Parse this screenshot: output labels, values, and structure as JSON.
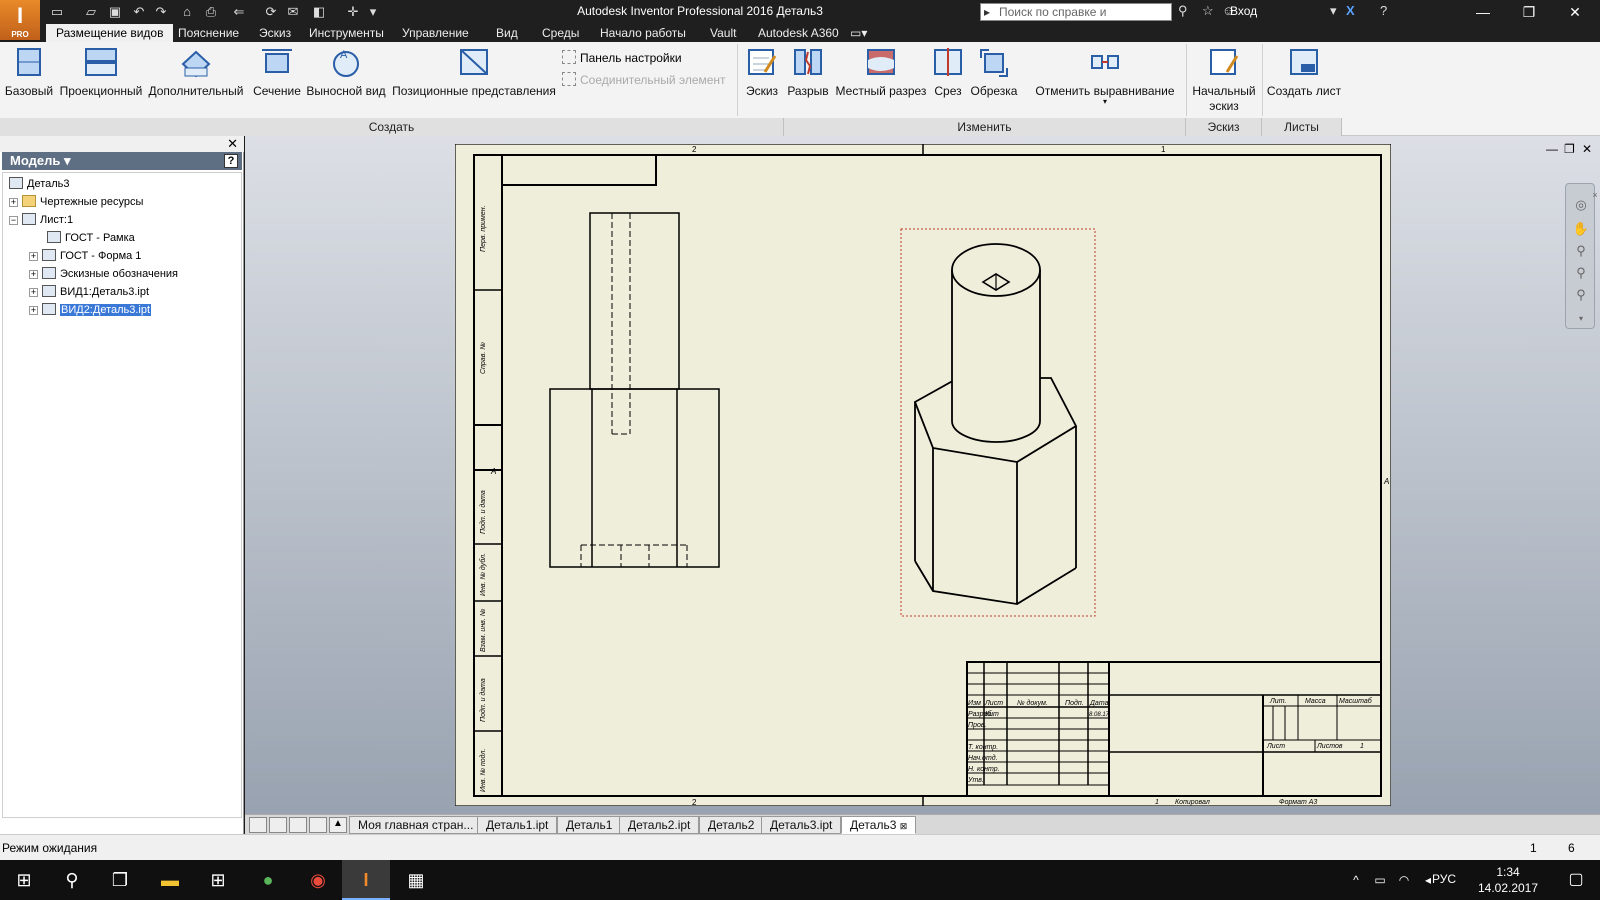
{
  "app": {
    "logo_letter": "I",
    "logo_sub": "PRO",
    "window_title": "Autodesk Inventor Professional 2016   Деталь3",
    "search_placeholder": "Поиск по справке и командам...",
    "signin": "Вход"
  },
  "ribbon_tabs": [
    "Размещение видов",
    "Пояснение",
    "Эскиз",
    "Инструменты",
    "Управление",
    "Вид",
    "Среды",
    "Начало работы",
    "Vault",
    "Autodesk A360"
  ],
  "ribbon": {
    "create_buttons": [
      "Базовый",
      "Проекционный",
      "Дополнительный",
      "Сечение",
      "Выносной вид",
      "Позиционные представления"
    ],
    "small_buttons": [
      "Панель настройки",
      "Соединительный элемент"
    ],
    "sketch_button": "Эскиз",
    "modify_buttons": [
      "Разрыв",
      "Местный разрез",
      "Срез",
      "Обрезка"
    ],
    "break_alignment": "Отменить выравнивание",
    "start_sketch": "Начальный эскиз",
    "new_sheet": "Создать лист",
    "groups": [
      "Создать",
      "Изменить",
      "Эскиз",
      "Листы"
    ]
  },
  "browser": {
    "title": "Модель",
    "help": "?",
    "tree": [
      "Деталь3",
      "Чертежные ресурсы",
      "Лист:1",
      "ГОСТ - Рамка",
      "ГОСТ - Форма 1",
      "Эскизные обозначения",
      "ВИД1:Деталь3.ipt",
      "ВИД2:Деталь3.ipt"
    ]
  },
  "sheet": {
    "zone_top_left": "2",
    "zone_top_right": "1",
    "zone_side": "A",
    "side_labels": [
      "Перв. примен.",
      "Справ. №",
      "Подп. и дата",
      "Инв. № дубл.",
      "Взам. инв. №",
      "Подп. и дата",
      "Инв. № подл."
    ],
    "title_block": {
      "headers": [
        "Изм",
        "Лист",
        "№ докум.",
        "Подп.",
        "Дата"
      ],
      "rows": [
        "Разраб.",
        "Пров.",
        "Т. контр.",
        "Нач.отд.",
        "Н. контр.",
        "Утв."
      ],
      "developer": "Кит",
      "date": "8.08.17",
      "lit": "Лит.",
      "mass": "Масса",
      "scale": "Масштаб",
      "sheet": "Лист",
      "sheets": "Листов",
      "sheets_count": "1",
      "copied": "Копировал",
      "format": "Формат А3",
      "copied_num": "1"
    }
  },
  "doc_tabs": [
    "Моя главная стран...",
    "Деталь1.ipt",
    "Деталь1",
    "Деталь2.ipt",
    "Деталь2",
    "Деталь3.ipt",
    "Деталь3"
  ],
  "status": {
    "text": "Режим ожидания",
    "num1": "1",
    "num2": "6"
  },
  "taskbar": {
    "lang": "РУС",
    "time": "1:34",
    "date": "14.02.2017"
  }
}
